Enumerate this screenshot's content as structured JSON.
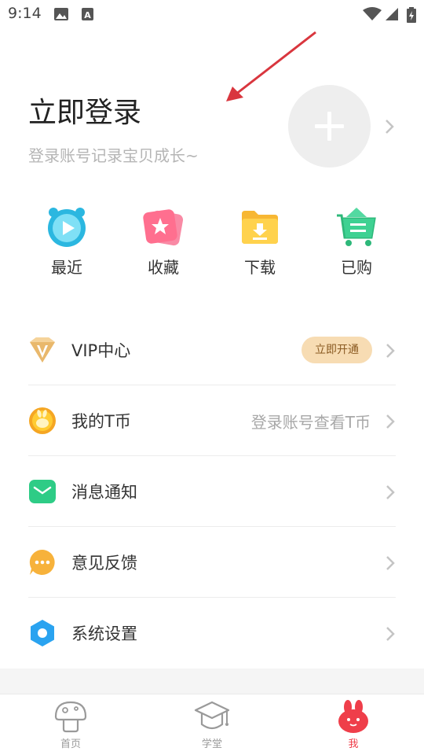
{
  "status_bar": {
    "time": "9:14"
  },
  "header": {
    "login_title": "立即登录",
    "login_subtitle": "登录账号记录宝贝成长~"
  },
  "quick_actions": [
    {
      "label": "最近",
      "icon": "recent-clock-icon"
    },
    {
      "label": "收藏",
      "icon": "favorites-star-icon"
    },
    {
      "label": "下载",
      "icon": "download-folder-icon"
    },
    {
      "label": "已购",
      "icon": "purchased-cart-icon"
    }
  ],
  "menu": {
    "vip": {
      "label": "VIP中心",
      "badge": "立即开通",
      "icon": "vip-diamond-icon"
    },
    "coins": {
      "label": "我的T币",
      "value": "登录账号查看T币",
      "icon": "coin-icon"
    },
    "messages": {
      "label": "消息通知",
      "icon": "message-envelope-icon"
    },
    "feedback": {
      "label": "意见反馈",
      "icon": "feedback-bubble-icon"
    },
    "settings": {
      "label": "系统设置",
      "icon": "settings-hexagon-icon"
    }
  },
  "tabs": [
    {
      "label": "首页",
      "icon": "home-mushroom-icon",
      "active": false
    },
    {
      "label": "学堂",
      "icon": "school-cap-icon",
      "active": false
    },
    {
      "label": "我",
      "icon": "me-rabbit-icon",
      "active": true
    }
  ],
  "colors": {
    "accent_red": "#ef3e4a",
    "vip_badge_bg": "#f7dcb3",
    "message_green": "#2ecc86",
    "settings_blue": "#2aa3f0",
    "feedback_orange": "#f7b23b"
  }
}
